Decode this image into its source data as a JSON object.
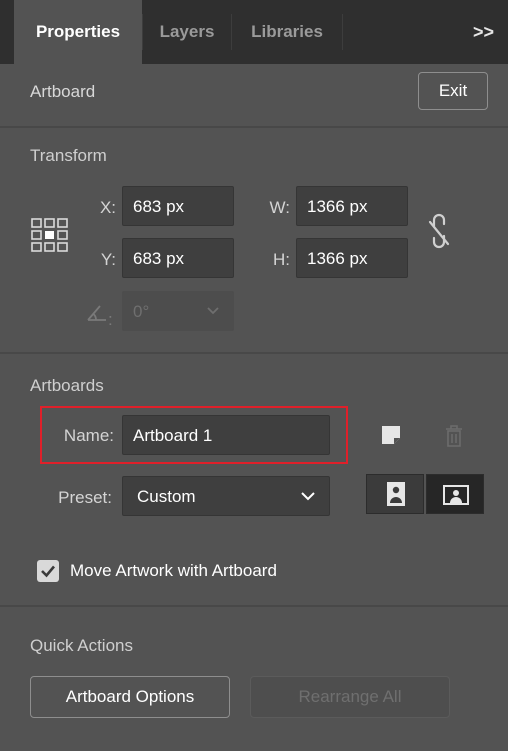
{
  "tabs": [
    {
      "label": "Properties",
      "active": true
    },
    {
      "label": "Layers",
      "active": false
    },
    {
      "label": "Libraries",
      "active": false
    }
  ],
  "tab_menu_icon": "chevron-double-right",
  "artboard_header": {
    "title": "Artboard",
    "exit_label": "Exit"
  },
  "transform": {
    "title": "Transform",
    "x_label": "X:",
    "x_value": "683 px",
    "y_label": "Y:",
    "y_value": "683 px",
    "w_label": "W:",
    "w_value": "1366 px",
    "h_label": "H:",
    "h_value": "1366 px",
    "rotate_value": "0°",
    "reference_point_icon": "reference-point-grid",
    "constrain_icon": "link-broken"
  },
  "artboards": {
    "title": "Artboards",
    "name_label": "Name:",
    "name_value": "Artboard 1",
    "preset_label": "Preset:",
    "preset_value": "Custom",
    "highlight_color": "#e0202a"
  },
  "move_artwork": {
    "label": "Move Artwork with Artboard",
    "checked": true
  },
  "quick_actions": {
    "title": "Quick Actions",
    "artboard_options_label": "Artboard Options",
    "rearrange_all_label": "Rearrange All"
  },
  "colors": {
    "panel_bg": "#535353",
    "tab_bar_bg": "#2f2f2f",
    "field_bg": "#3f3f3f"
  }
}
